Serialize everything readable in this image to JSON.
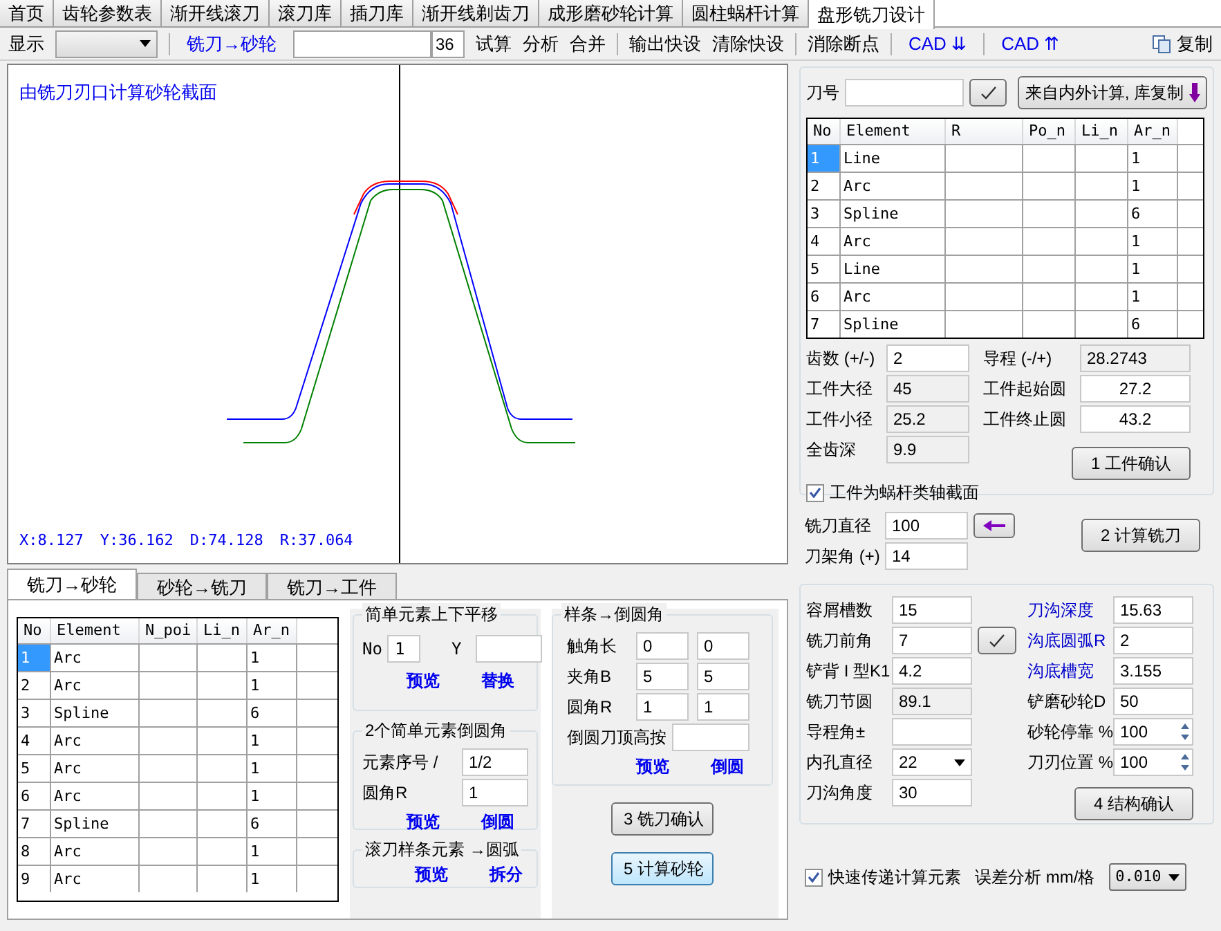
{
  "tabs": [
    {
      "label": "首页",
      "selected": false
    },
    {
      "label": "齿轮参数表",
      "selected": false
    },
    {
      "label": "渐开线滚刀",
      "selected": false
    },
    {
      "label": "滚刀库",
      "selected": false
    },
    {
      "label": "插刀库",
      "selected": false
    },
    {
      "label": "渐开线剃齿刀",
      "selected": false
    },
    {
      "label": "成形磨砂轮计算",
      "selected": false
    },
    {
      "label": "圆柱蜗杆计算",
      "selected": false
    },
    {
      "label": "盘形铣刀设计",
      "selected": true
    }
  ],
  "toolbar": {
    "groups": [
      [
        {
          "kind": "label",
          "text": "显示"
        },
        {
          "kind": "select"
        }
      ],
      [
        {
          "kind": "link",
          "text": "铣刀→砂轮"
        },
        {
          "kind": "input"
        },
        {
          "kind": "count",
          "text": "36"
        },
        {
          "kind": "button",
          "text": "试算"
        },
        {
          "kind": "button",
          "text": "分析"
        },
        {
          "kind": "button",
          "text": "合并"
        }
      ],
      [
        {
          "kind": "button",
          "text": "输出快设"
        },
        {
          "kind": "button",
          "text": "清除快设"
        }
      ],
      [
        {
          "kind": "button",
          "text": "消除断点"
        }
      ],
      [
        {
          "kind": "link",
          "text": "CAD ⇊"
        }
      ],
      [
        {
          "kind": "link",
          "text": "CAD ⇈"
        }
      ]
    ],
    "copy": "复制"
  },
  "canvas": {
    "title": "由铣刀刃口计算砂轮截面",
    "readouts": [
      "X:8.127",
      "Y:36.162",
      "D:74.128",
      "R:37.064"
    ]
  },
  "bottom_tabs": [
    {
      "label": "铣刀→砂轮",
      "selected": true
    },
    {
      "label": "砂轮→铣刀",
      "selected": false
    },
    {
      "label": "铣刀→工件",
      "selected": false
    }
  ],
  "element_table": {
    "columns": [
      "No",
      "Element",
      "N_poi",
      "Li_n",
      "Ar_n"
    ],
    "rows": [
      {
        "cells": [
          "1",
          "Arc",
          "",
          "",
          "1"
        ],
        "selected": true
      },
      {
        "cells": [
          "2",
          "Arc",
          "",
          "",
          "1"
        ],
        "selected": false
      },
      {
        "cells": [
          "3",
          "Spline",
          "",
          "",
          "6"
        ],
        "selected": false
      },
      {
        "cells": [
          "4",
          "Arc",
          "",
          "",
          "1"
        ],
        "selected": false
      },
      {
        "cells": [
          "5",
          "Arc",
          "",
          "",
          "1"
        ],
        "selected": false
      },
      {
        "cells": [
          "6",
          "Arc",
          "",
          "",
          "1"
        ],
        "selected": false
      },
      {
        "cells": [
          "7",
          "Spline",
          "",
          "",
          "6"
        ],
        "selected": false
      },
      {
        "cells": [
          "8",
          "Arc",
          "",
          "",
          "1"
        ],
        "selected": false
      },
      {
        "cells": [
          "9",
          "Arc",
          "",
          "",
          "1"
        ],
        "selected": false
      }
    ]
  },
  "shift_group": {
    "title": "简单元素上下平移",
    "no_label": "No",
    "no_value": "1",
    "y_label": "Y",
    "actions": [
      "预览",
      "替换"
    ]
  },
  "fillet_group": {
    "title": "2个简单元素倒圆角",
    "fields": [
      {
        "label": "元素序号 /",
        "value": "1/2"
      },
      {
        "label": "圆角R",
        "value": "1"
      }
    ],
    "actions": [
      "预览",
      "倒圆"
    ]
  },
  "split_group": {
    "title": "滚刀样条元素 →圆弧",
    "actions": [
      "预览",
      "拆分"
    ]
  },
  "spline_group": {
    "title": "样条→倒圆角",
    "rows": [
      {
        "label": "触角长",
        "values": [
          "0",
          "0"
        ]
      },
      {
        "label": "夹角B",
        "values": [
          "5",
          "5"
        ]
      },
      {
        "label": "圆角R",
        "values": [
          "1",
          "1"
        ]
      }
    ],
    "top_label": "倒圆刀顶高按",
    "actions": [
      "预览",
      "倒圆"
    ]
  },
  "left_buttons": [
    {
      "label": "3 铣刀确认",
      "focused": false
    },
    {
      "label": "5 计算砂轮",
      "focused": true
    }
  ],
  "tool": {
    "label": "刀号",
    "copy_button": "来自内外计算, 库复制"
  },
  "profile_table": {
    "columns": [
      "No",
      "Element",
      "R",
      "Po_n",
      "Li_n",
      "Ar_n"
    ],
    "rows": [
      {
        "cells": [
          "1",
          "Line",
          "",
          "",
          "",
          "1"
        ],
        "selected": true
      },
      {
        "cells": [
          "2",
          "Arc",
          "",
          "",
          "",
          "1"
        ],
        "selected": false
      },
      {
        "cells": [
          "3",
          "Spline",
          "",
          "",
          "",
          "6"
        ],
        "selected": false
      },
      {
        "cells": [
          "4",
          "Arc",
          "",
          "",
          "",
          "1"
        ],
        "selected": false
      },
      {
        "cells": [
          "5",
          "Line",
          "",
          "",
          "",
          "1"
        ],
        "selected": false
      },
      {
        "cells": [
          "6",
          "Arc",
          "",
          "",
          "",
          "1"
        ],
        "selected": false
      },
      {
        "cells": [
          "7",
          "Spline",
          "",
          "",
          "",
          "6"
        ],
        "selected": false
      }
    ]
  },
  "workpiece": {
    "left": [
      {
        "label": "齿数 (+/-)",
        "value": "2",
        "readonly": false
      },
      {
        "label": "工件大径",
        "value": "45",
        "readonly": true
      },
      {
        "label": "工件小径",
        "value": "25.2",
        "readonly": true
      },
      {
        "label": "全齿深",
        "value": "9.9",
        "readonly": true
      }
    ],
    "right": [
      {
        "label": "导程 (-/+)",
        "value": "28.2743",
        "readonly": true
      },
      {
        "label": "工件起始圆",
        "value": "27.2",
        "readonly": false
      },
      {
        "label": "工件终止圆",
        "value": "43.2",
        "readonly": false
      }
    ],
    "checkbox": {
      "label": "工件为蜗杆类轴截面",
      "checked": true
    },
    "button": "1 工件确认"
  },
  "cutter": {
    "fields": [
      {
        "label": "铣刀直径",
        "value": "100"
      },
      {
        "label": "刀架角 (+)",
        "value": "14"
      }
    ],
    "button": "2 计算铣刀"
  },
  "structure": {
    "left": [
      {
        "label": "容屑槽数",
        "value": "15",
        "kind": "text"
      },
      {
        "label": "铣刀前角",
        "value": "7",
        "kind": "text"
      },
      {
        "label": "铲背 I 型K1",
        "value": "4.2",
        "kind": "text"
      },
      {
        "label": "铣刀节圆",
        "value": "89.1",
        "kind": "readonly"
      },
      {
        "label": "导程角±",
        "kind": "text"
      },
      {
        "label": "内孔直径",
        "value": "22",
        "kind": "select"
      },
      {
        "label": "刀沟角度",
        "value": "30",
        "kind": "text"
      }
    ],
    "right": [
      {
        "label": "刀沟深度",
        "value": "15.63",
        "kind": "text",
        "color": "#0000cc"
      },
      {
        "label": "沟底圆弧R",
        "value": "2",
        "kind": "text",
        "color": "#0000cc"
      },
      {
        "label": "沟底槽宽",
        "value": "3.155",
        "kind": "text",
        "color": "#0000cc"
      },
      {
        "label": "铲磨砂轮D",
        "value": "50",
        "kind": "text",
        "color": "#000000"
      },
      {
        "label": "砂轮停靠 %",
        "value": "100",
        "kind": "spin",
        "color": "#000000"
      },
      {
        "label": "刀刃位置 %",
        "value": "100",
        "kind": "spin",
        "color": "#000000"
      }
    ],
    "button": "4 结构确认"
  },
  "footer": {
    "checkbox": {
      "label": "快速传递计算元素",
      "checked": true
    },
    "error_label": "误差分析 mm/格",
    "error_value": "0.010"
  }
}
